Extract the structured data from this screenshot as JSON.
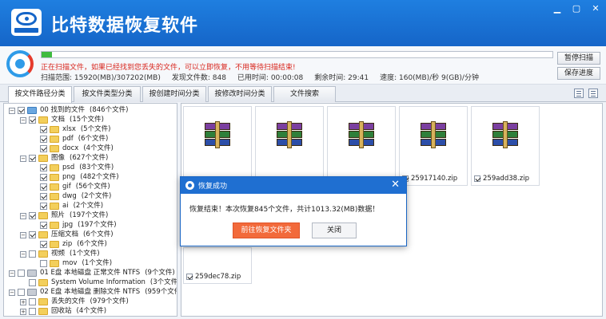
{
  "app": {
    "title": "比特数据恢复软件"
  },
  "window_controls": {
    "minimize": "▁",
    "maximize": "▢",
    "close": "✕"
  },
  "status": {
    "progress": 0.02,
    "message": "正在扫描文件，如果已经找到您丢失的文件，可以立即恢复，不用等待扫描结束!",
    "range_label": "扫描范围: 15920(MB)/307202(MB)",
    "found_label": "发现文件数: 848",
    "elapsed_label": "已用时间: 00:00:08",
    "remaining_label": "剩余时间: 29:41",
    "speed_label": "速度: 160(MB)/秒 9(GB)/分钟",
    "pause_button": "暂停扫描",
    "save_button": "保存进度"
  },
  "tabs": [
    {
      "label": "按文件路径分类"
    },
    {
      "label": "按文件类型分类"
    },
    {
      "label": "按创建时间分类"
    },
    {
      "label": "按修改时间分类"
    },
    {
      "label": "文件搜索"
    }
  ],
  "tree": [
    {
      "name": "00 找到的文件",
      "count": "(846个文件)"
    },
    {
      "name": "文档",
      "count": "(15个文件)"
    },
    {
      "name": "xlsx",
      "count": "(5个文件)"
    },
    {
      "name": "pdf",
      "count": "(6个文件)"
    },
    {
      "name": "docx",
      "count": "(4个文件)"
    },
    {
      "name": "图像",
      "count": "(627个文件)"
    },
    {
      "name": "psd",
      "count": "(83个文件)"
    },
    {
      "name": "png",
      "count": "(482个文件)"
    },
    {
      "name": "gif",
      "count": "(56个文件)"
    },
    {
      "name": "dwg",
      "count": "(2个文件)"
    },
    {
      "name": "ai",
      "count": "(2个文件)"
    },
    {
      "name": "照片",
      "count": "(197个文件)"
    },
    {
      "name": "jpg",
      "count": "(197个文件)"
    },
    {
      "name": "压缩文档",
      "count": "(6个文件)"
    },
    {
      "name": "zip",
      "count": "(6个文件)"
    },
    {
      "name": "视频",
      "count": "(1个文件)"
    },
    {
      "name": "mov",
      "count": "(1个文件)"
    },
    {
      "name": "01 E盘 本地磁盘 正常文件 NTFS",
      "count": "(9个文件)"
    },
    {
      "name": "System Volume Information",
      "count": "(3个文件)"
    },
    {
      "name": "02 E盘 本地磁盘 删除文件 NTFS",
      "count": "(959个文件)"
    },
    {
      "name": "丢失的文件",
      "count": "(979个文件)"
    },
    {
      "name": "回收站",
      "count": "(4个文件)"
    }
  ],
  "files": [
    {
      "name": ""
    },
    {
      "name": ""
    },
    {
      "name": ""
    },
    {
      "name": "25917140.zip"
    },
    {
      "name": "259add38.zip"
    },
    {
      "name": "259dec78.zip"
    }
  ],
  "dialog": {
    "title": "恢复成功",
    "message": "恢复结束！本次恢复845个文件，共计1013.32(MB)数据！",
    "open_button": "前往恢复文件夹",
    "close_button": "关闭",
    "close_icon": "✕"
  }
}
